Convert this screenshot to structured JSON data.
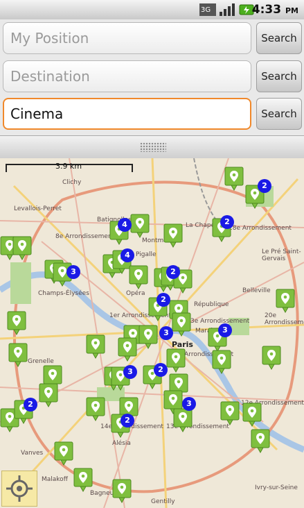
{
  "status_bar": {
    "time": "4:33",
    "ampm": "PM",
    "network_label": "3G",
    "icons": [
      "network-3g-icon",
      "signal-strength-icon",
      "battery-charging-icon"
    ]
  },
  "form": {
    "my_position_placeholder": "My Position",
    "destination_placeholder": "Destination",
    "query_value": "Cinema",
    "search_label_1": "Search",
    "search_label_2": "Search",
    "search_label_3": "Search"
  },
  "map": {
    "scale_label": "3.9 km",
    "place_labels": [
      "Clichy",
      "Levallois-Perret",
      "8e Arrondissement",
      "Montmartre",
      "La Chapelle",
      "18e Arrondissement",
      "Le Pré Saint-Gervais",
      "Pigalle",
      "Batignolles",
      "Champs-Élysées",
      "Opéra",
      "République",
      "Belleville",
      "20e Arrondissement",
      "1er Arrondissement",
      "Paris",
      "Marais",
      "3e Arrondissement",
      "4e Arrondissement",
      "Grenelle",
      "12e Arrondissement",
      "13e Arrondissement",
      "14e Arrondissement",
      "Alésia",
      "Malakoff",
      "Gentilly",
      "Ivry-sur-Seine",
      "Bagneux",
      "Vanves"
    ],
    "clusters": [
      "4",
      "4",
      "2",
      "2",
      "2",
      "3",
      "3",
      "2",
      "3",
      "3",
      "2",
      "2",
      "3",
      "2"
    ],
    "colors": {
      "marker": "#7fbf3f",
      "cluster": "#1a1ae6",
      "accent": "#f0882a"
    }
  }
}
